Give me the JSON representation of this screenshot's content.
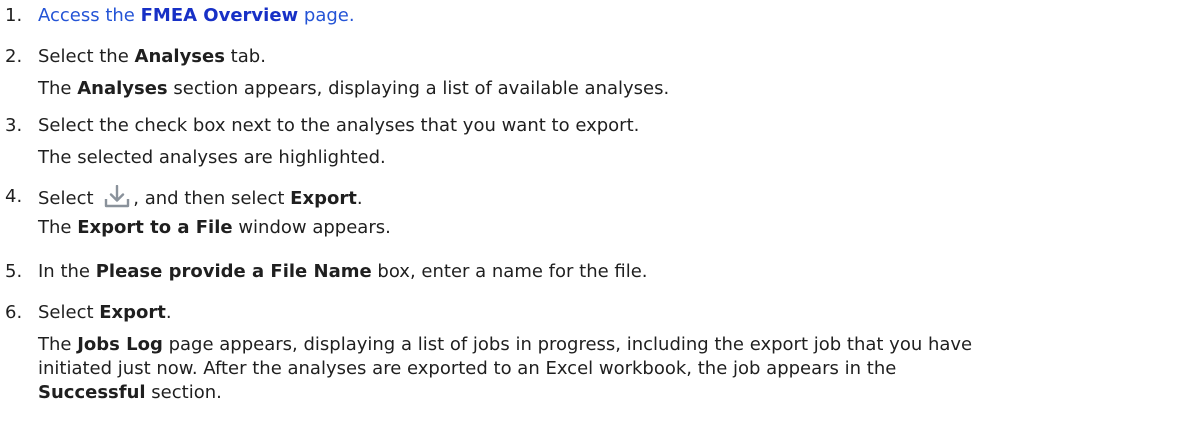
{
  "steps": [
    {
      "num": "1.",
      "pre": "Access the ",
      "bold": "FMEA Overview",
      "post": " page."
    },
    {
      "num": "2.",
      "pre": "Select the ",
      "bold": "Analyses",
      "post": " tab.",
      "result_pre": "The ",
      "result_bold": "Analyses",
      "result_post": " section appears, displaying a list of available analyses."
    },
    {
      "num": "3.",
      "text": "Select the check box next to the analyses that you want to export.",
      "result": "The selected analyses are highlighted."
    },
    {
      "num": "4.",
      "pre": "Select ",
      "icon": "download-icon",
      "mid": ", and then select ",
      "bold": "Export",
      "post": ".",
      "result_pre": "The ",
      "result_bold": "Export to a File",
      "result_post": " window appears."
    },
    {
      "num": "5.",
      "pre": "In the ",
      "bold": "Please provide a File Name",
      "post": " box, enter a name for the file."
    },
    {
      "num": "6.",
      "pre": "Select ",
      "bold": "Export",
      "post": ".",
      "result_pre": "The ",
      "result_bold": "Jobs Log",
      "result_mid": " page appears, displaying a list of jobs in progress, including the export job that you have",
      "result_line2": "initiated just now. After the analyses are exported to an Excel workbook, the job appears in the",
      "result_bold2": "Successful",
      "result_post": " section."
    }
  ],
  "colors": {
    "text": "#1f1f1f",
    "link": "#2454d6",
    "icon": "#8a929b"
  }
}
